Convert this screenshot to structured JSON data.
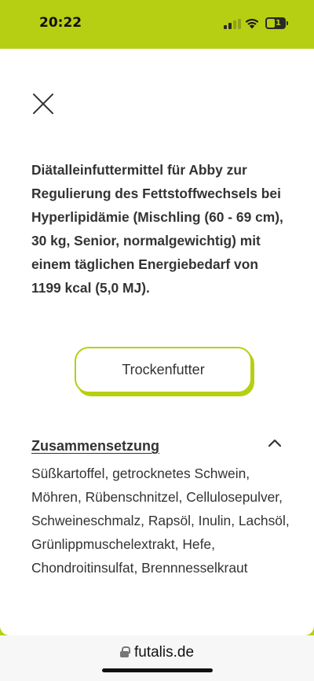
{
  "status_bar": {
    "time": "20:22",
    "battery_level": "41",
    "accent_color": "#b7cf12"
  },
  "header": {
    "close_icon": "close-icon"
  },
  "product": {
    "description": "Diätalleinfuttermittel für Abby zur Regulierung des Fettstoffwechsels bei Hyperlipidämie (Mischling (60 - 69 cm), 30 kg, Senior, normalgewichtig) mit einem täglichen Energiebedarf von 1199 kcal (5,0 MJ).",
    "type_button_label": "Trockenfutter"
  },
  "composition": {
    "title": "Zusammensetzung",
    "expanded": true,
    "toggle_icon": "chevron-up-icon",
    "text": "Süßkartoffel, getrocknetes Schwein, Möhren, Rübenschnitzel, Cellulosepulver, Schweineschmalz, Rapsöl, Inulin, Lachsöl, Grünlippmuschelextrakt, Hefe, Chondroitinsulfat, Brennnesselkraut"
  },
  "browser": {
    "url": "futalis.de",
    "lock_icon": "lock-icon"
  }
}
